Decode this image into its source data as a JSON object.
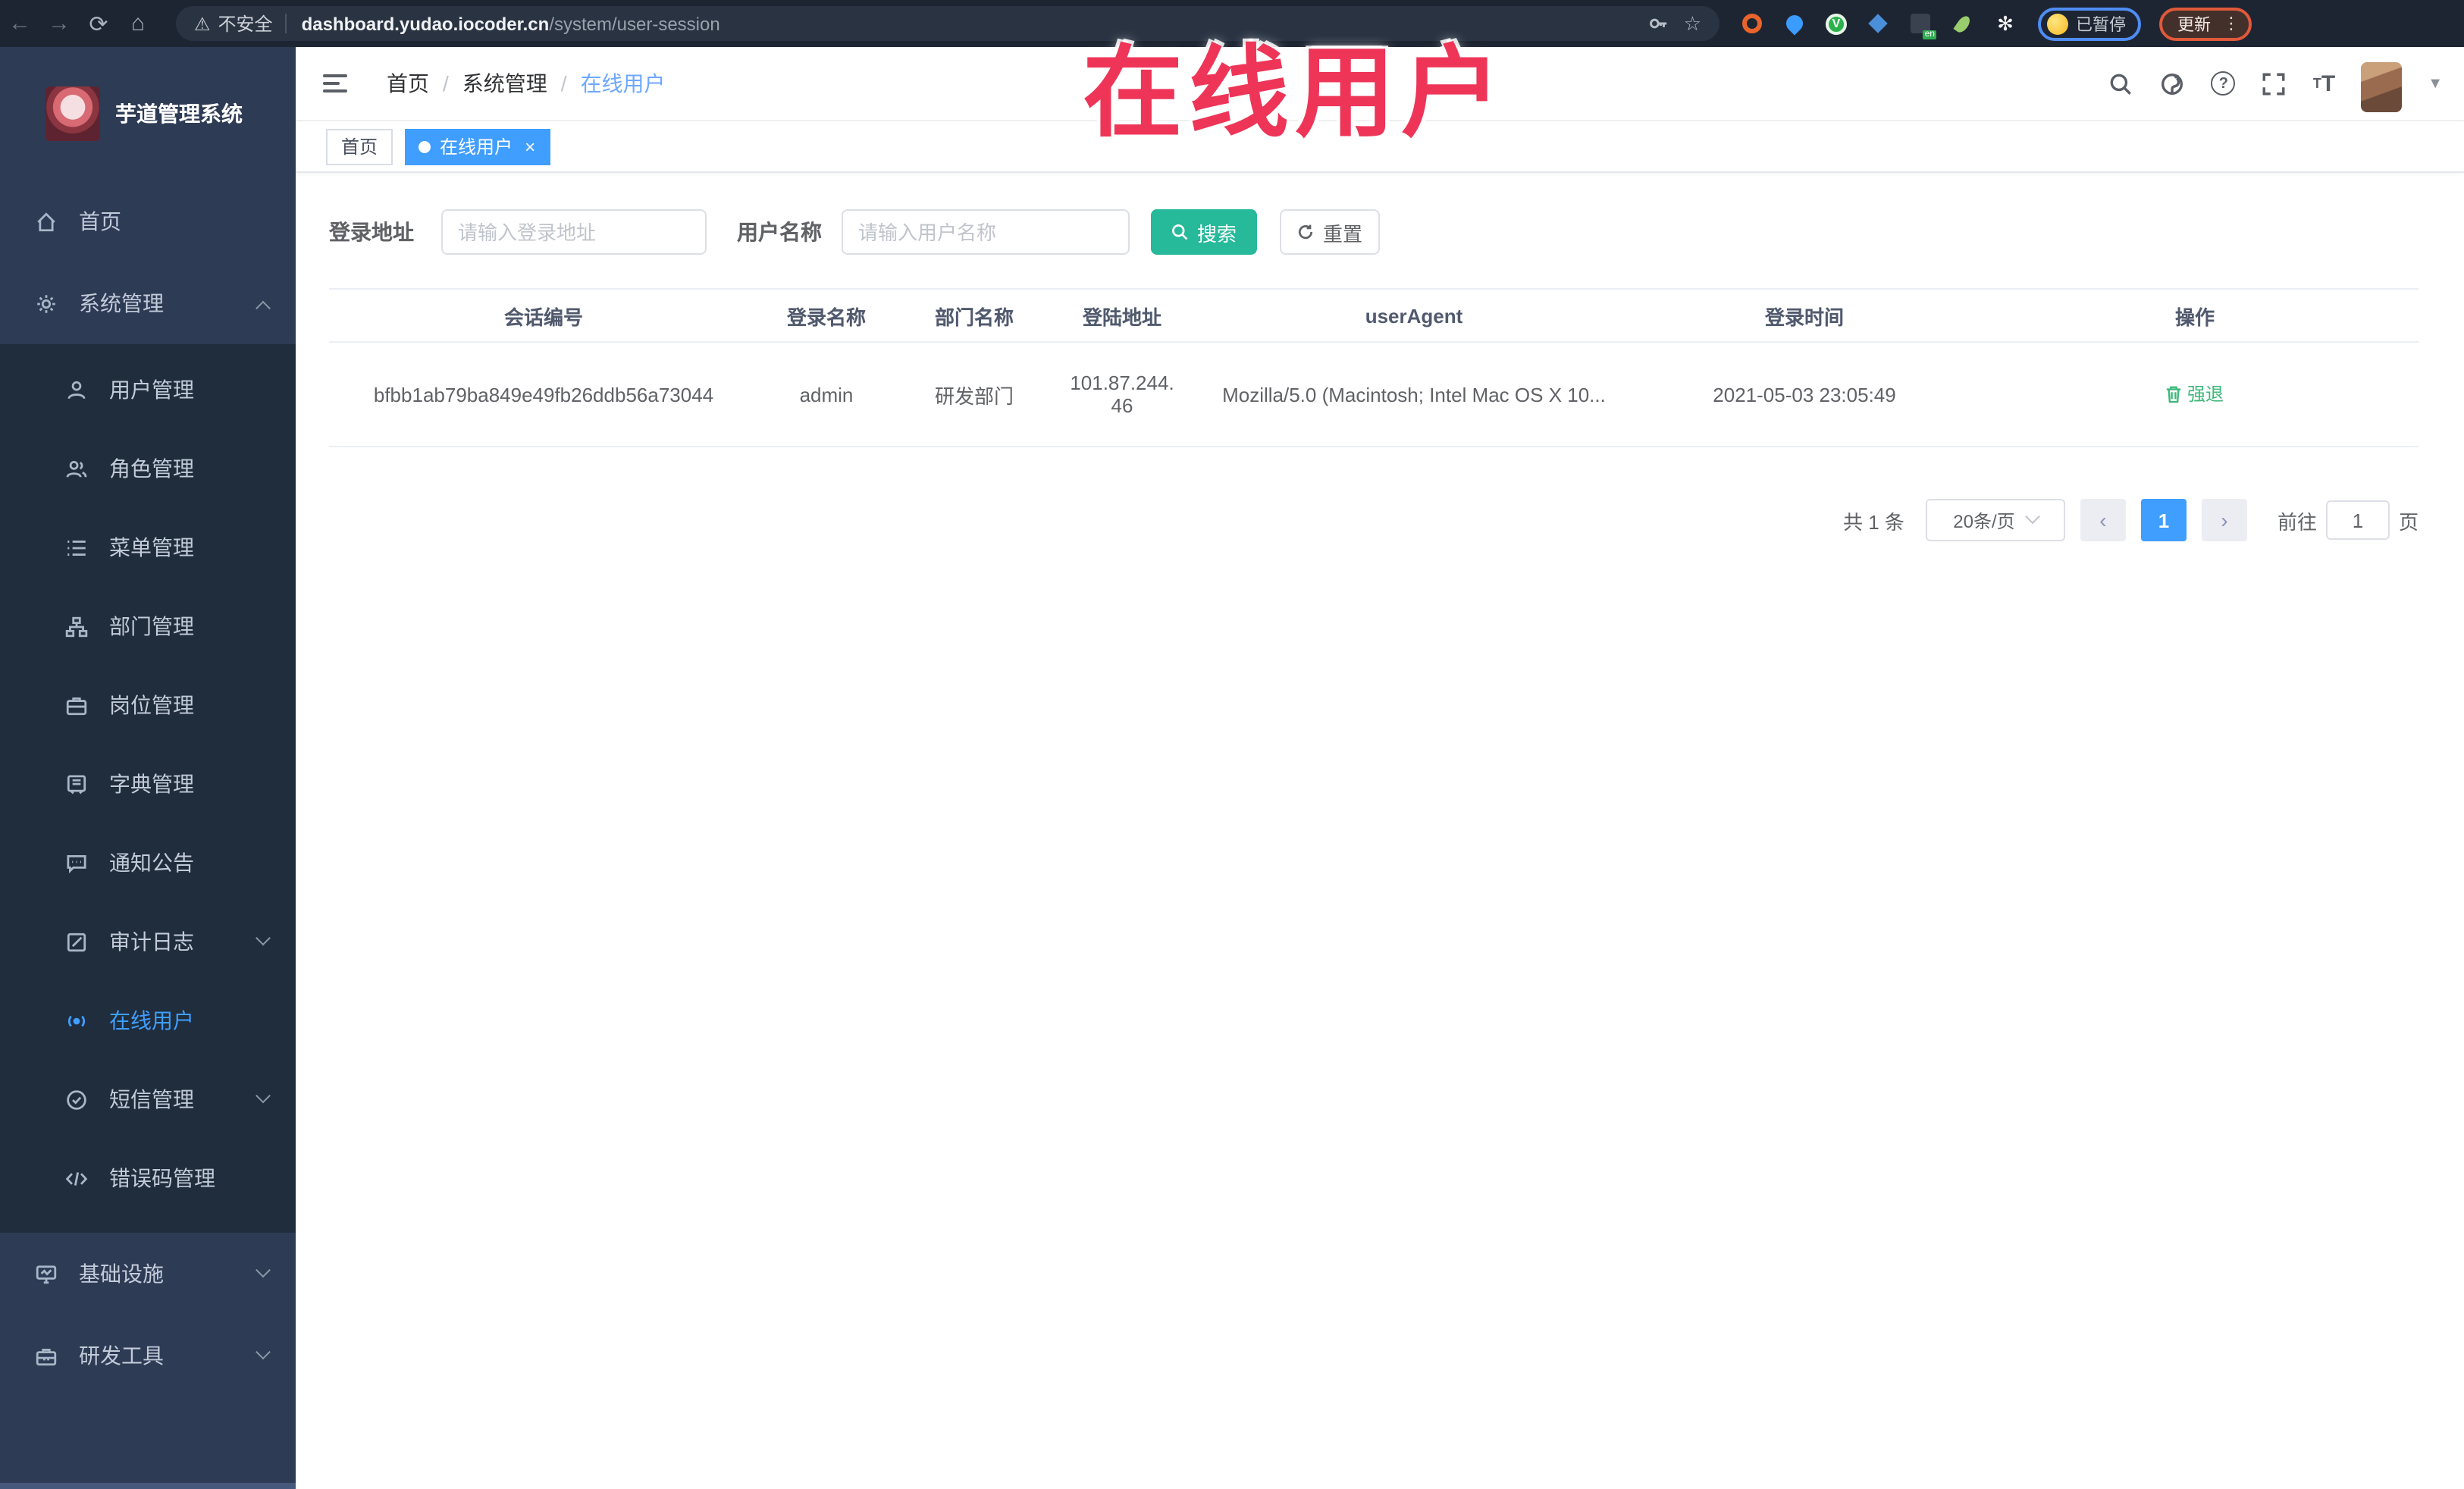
{
  "browser": {
    "security_label": "不安全",
    "url_host": "dashboard.yudao.iocoder.cn",
    "url_path": "/system/user-session",
    "paused_label": "已暂停",
    "update_label": "更新",
    "kebab": "⋮",
    "back": "←",
    "forward": "→",
    "reload": "⟳",
    "home": "⌂",
    "warning": "⚠",
    "star": "☆",
    "flower": "✻",
    "translate_badge": "en",
    "green_ext_letter": "V"
  },
  "overlay": {
    "title": "在线用户"
  },
  "sidebar": {
    "app_title": "芋道管理系统",
    "items": [
      {
        "label": "首页"
      },
      {
        "label": "系统管理"
      },
      {
        "label": "用户管理"
      },
      {
        "label": "角色管理"
      },
      {
        "label": "菜单管理"
      },
      {
        "label": "部门管理"
      },
      {
        "label": "岗位管理"
      },
      {
        "label": "字典管理"
      },
      {
        "label": "通知公告"
      },
      {
        "label": "审计日志"
      },
      {
        "label": "在线用户"
      },
      {
        "label": "短信管理"
      },
      {
        "label": "错误码管理"
      },
      {
        "label": "基础设施"
      },
      {
        "label": "研发工具"
      }
    ]
  },
  "header": {
    "breadcrumb": {
      "home": "首页",
      "sep1": "/",
      "section": "系统管理",
      "sep2": "/",
      "current": "在线用户"
    },
    "help_glyph": "?",
    "font_size_big": "T",
    "font_size_small": "T",
    "caret": "▼"
  },
  "tags": {
    "home": "首页",
    "current": "在线用户",
    "close": "×"
  },
  "filters": {
    "login_address_label": "登录地址",
    "login_address_placeholder": "请输入登录地址",
    "username_label": "用户名称",
    "username_placeholder": "请输入用户名称",
    "search_label": "搜索",
    "reset_label": "重置"
  },
  "table": {
    "columns": [
      "会话编号",
      "登录名称",
      "部门名称",
      "登陆地址",
      "userAgent",
      "登录时间",
      "操作"
    ],
    "rows": [
      {
        "session_id": "bfbb1ab79ba849e49fb26ddb56a73044",
        "login_name": "admin",
        "dept_name": "研发部门",
        "login_address": "101.87.244.46",
        "user_agent": "Mozilla/5.0 (Macintosh; Intel Mac OS X 10...",
        "login_time": "2021-05-03 23:05:49",
        "action": "强退"
      }
    ]
  },
  "pagination": {
    "total": "共 1 条",
    "page_size": "20条/页",
    "prev": "‹",
    "next": "›",
    "page": "1",
    "goto_label": "前往",
    "goto_value": "1",
    "page_label": "页"
  },
  "colors": {
    "accent": "#409eff",
    "search_button": "#26b99a",
    "action_green": "#3db87a",
    "overlay_red": "#ee3558",
    "sidebar_bg": "#2e3b55",
    "submenu_bg": "#1f2d3d",
    "chrome_bg": "#1e2532"
  }
}
